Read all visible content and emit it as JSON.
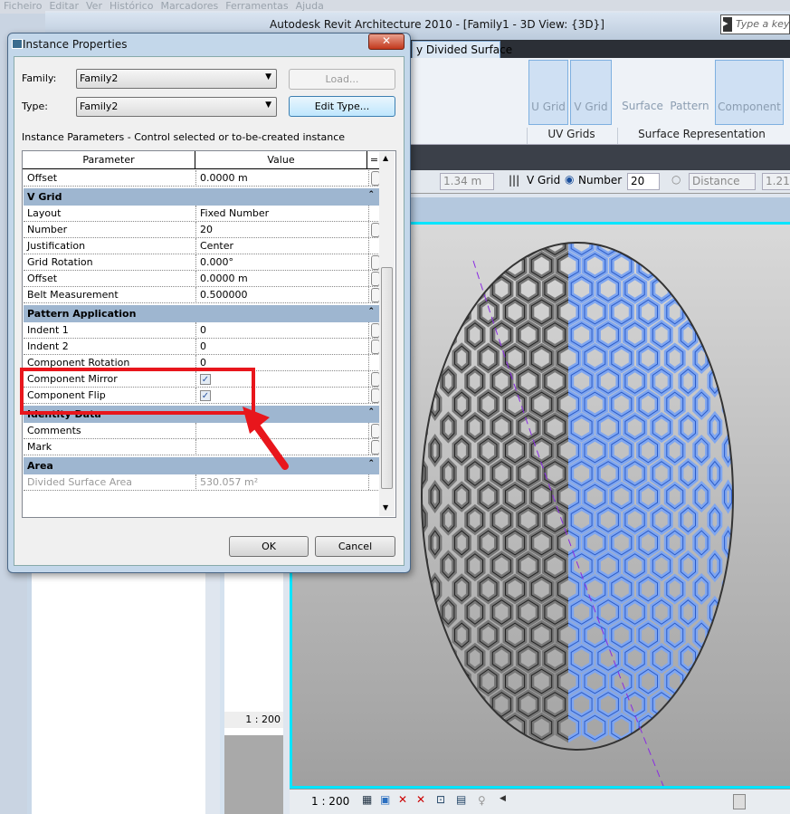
{
  "os_menu": [
    "Ficheiro",
    "Editar",
    "Ver",
    "Histórico",
    "Marcadores",
    "Ferramentas",
    "Ajuda"
  ],
  "app": {
    "title": "Autodesk Revit Architecture 2010 - [Family1 - 3D View: {3D}]",
    "search_placeholder": "Type a keyword"
  },
  "ribbon": {
    "active_tab": "y Divided Surface",
    "buttons": [
      {
        "label": "U Grid"
      },
      {
        "label": "V Grid"
      },
      {
        "label": "Surface"
      },
      {
        "label": "Pattern"
      },
      {
        "label": "Component"
      }
    ],
    "panels": [
      "UV Grids",
      "Surface Representation"
    ]
  },
  "options_bar": {
    "u_distance": "1.34 m",
    "v_grid_label": "V Grid",
    "number_label": "Number",
    "number_value": "20",
    "distance_label": "Distance",
    "distance_value": "1.21"
  },
  "view": {
    "scale": "1 : 200",
    "browser_scale": "1 : 200"
  },
  "dialog": {
    "title": "Instance Properties",
    "family_label": "Family:",
    "family_value": "Family2",
    "type_label": "Type:",
    "type_value": "Family2",
    "load_label": "Load...",
    "edit_type_label": "Edit Type...",
    "instance_caption": "Instance Parameters - Control selected or to-be-created instance",
    "col_parameter": "Parameter",
    "col_value": "Value",
    "rows": [
      {
        "kind": "param",
        "name": "Offset",
        "value": "0.0000 m",
        "editable": true
      },
      {
        "kind": "group",
        "name": "V Grid"
      },
      {
        "kind": "param",
        "name": "Layout",
        "value": "Fixed Number",
        "editable": false
      },
      {
        "kind": "param",
        "name": "Number",
        "value": "20",
        "editable": true
      },
      {
        "kind": "param",
        "name": "Justification",
        "value": "Center",
        "editable": false
      },
      {
        "kind": "param",
        "name": "Grid Rotation",
        "value": "0.000°",
        "editable": true
      },
      {
        "kind": "param",
        "name": "Offset",
        "value": "0.0000 m",
        "editable": true
      },
      {
        "kind": "param",
        "name": "Belt Measurement",
        "value": "0.500000",
        "editable": true
      },
      {
        "kind": "group",
        "name": "Pattern Application"
      },
      {
        "kind": "param",
        "name": "Indent 1",
        "value": "0",
        "editable": true
      },
      {
        "kind": "param",
        "name": "Indent 2",
        "value": "0",
        "editable": true
      },
      {
        "kind": "param",
        "name": "Component Rotation",
        "value": "0",
        "editable": false
      },
      {
        "kind": "check",
        "name": "Component Mirror",
        "checked": true,
        "editable": true
      },
      {
        "kind": "check",
        "name": "Component Flip",
        "checked": true,
        "editable": true
      },
      {
        "kind": "group",
        "name": "Identity Data"
      },
      {
        "kind": "param",
        "name": "Comments",
        "value": "",
        "editable": true
      },
      {
        "kind": "param",
        "name": "Mark",
        "value": "",
        "editable": true
      },
      {
        "kind": "group",
        "name": "Area"
      },
      {
        "kind": "param",
        "name": "Divided Surface Area",
        "value": "530.057 m²",
        "editable": false,
        "dim": true
      }
    ],
    "ok_label": "OK",
    "cancel_label": "Cancel"
  },
  "colors": {
    "highlight": "#e8161c",
    "selection": "#7fa6f0",
    "mesh": "#777777",
    "viewport_border": "#00e5ff"
  }
}
